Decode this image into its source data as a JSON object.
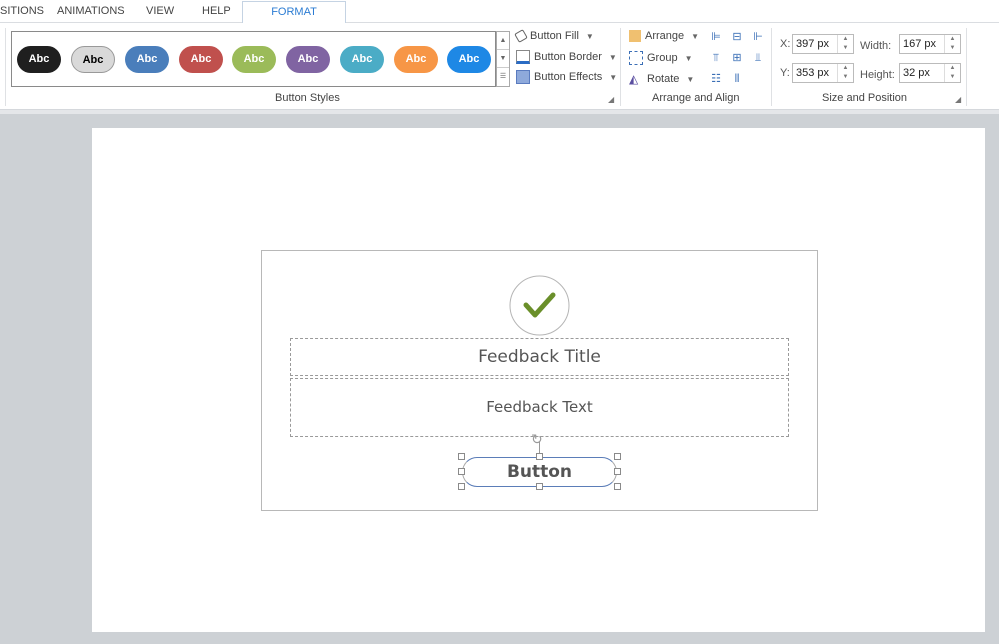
{
  "tabs": [
    {
      "label": "SITIONS"
    },
    {
      "label": "ANIMATIONS"
    },
    {
      "label": "VIEW"
    },
    {
      "label": "HELP"
    },
    {
      "label": "FORMAT",
      "active": true
    }
  ],
  "button_styles": {
    "group_label": "Button Styles",
    "styles": [
      {
        "label": "Abc",
        "bg": "#1f1f1f",
        "fg": "#ffffff"
      },
      {
        "label": "Abc",
        "bg": "#d9d9d9",
        "fg": "#000000"
      },
      {
        "label": "Abc",
        "bg": "#4a7ebb",
        "fg": "#ffffff"
      },
      {
        "label": "Abc",
        "bg": "#c0504d",
        "fg": "#ffffff"
      },
      {
        "label": "Abc",
        "bg": "#9bbb59",
        "fg": "#ffffff"
      },
      {
        "label": "Abc",
        "bg": "#8064a2",
        "fg": "#ffffff"
      },
      {
        "label": "Abc",
        "bg": "#4bacc6",
        "fg": "#ffffff"
      },
      {
        "label": "Abc",
        "bg": "#f79646",
        "fg": "#ffffff"
      },
      {
        "label": "Abc",
        "bg": "#1e88e5",
        "fg": "#ffffff"
      }
    ],
    "fill": "Button Fill",
    "border": "Button Border",
    "effects": "Button Effects"
  },
  "arrange": {
    "group_label": "Arrange and Align",
    "arrange": "Arrange",
    "group": "Group",
    "rotate": "Rotate"
  },
  "size_position": {
    "group_label": "Size and Position",
    "x_label": "X:",
    "x": "397 px",
    "y_label": "Y:",
    "y": "353 px",
    "width_label": "Width:",
    "width": "167 px",
    "height_label": "Height:",
    "height": "32 px"
  },
  "slide": {
    "title": "Feedback Title",
    "text": "Feedback Text",
    "button": "Button",
    "check_color": "#6a8f2a"
  }
}
